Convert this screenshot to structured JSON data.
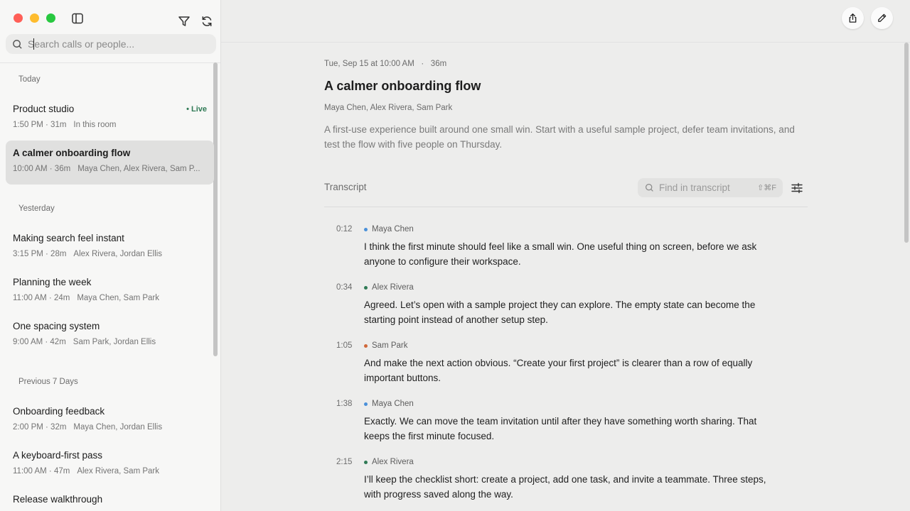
{
  "sidebar": {
    "search_placeholder": "Search calls or people...",
    "groups": [
      {
        "label": "Today"
      },
      {
        "label": "Yesterday"
      },
      {
        "label": "Previous 7 Days"
      }
    ],
    "items": [
      {
        "title": "Product studio",
        "time": "1:50 PM · 31m",
        "people": "In this room",
        "badge": "• Live"
      },
      {
        "title": "A calmer onboarding flow",
        "time": "10:00 AM · 36m",
        "people": "Maya Chen, Alex Rivera, Sam P..."
      },
      {
        "title": "Making search feel instant",
        "time": "3:15 PM · 28m",
        "people": "Alex Rivera, Jordan Ellis"
      },
      {
        "title": "Planning the week",
        "time": "11:00 AM · 24m",
        "people": "Maya Chen, Sam Park"
      },
      {
        "title": "One spacing system",
        "time": "9:00 AM · 42m",
        "people": "Sam Park, Jordan Ellis"
      },
      {
        "title": "Onboarding feedback",
        "time": "2:00 PM · 32m",
        "people": "Maya Chen, Jordan Ellis"
      },
      {
        "title": "A keyboard-first pass",
        "time": "11:00 AM · 47m",
        "people": "Alex Rivera, Sam Park"
      },
      {
        "title": "Release walkthrough",
        "time": "",
        "people": ""
      }
    ]
  },
  "main": {
    "date_line": "Tue, Sep 15 at 10:00 AM   ·   36m",
    "title": "A calmer onboarding flow",
    "participants": "Maya Chen, Alex Rivera, Sam Park",
    "summary": "A first-use experience built around one small win. Start with a useful sample project, defer team invitations, and test the flow with five people on Thursday.",
    "transcript_label": "Transcript",
    "find_placeholder": "Find in transcript",
    "find_shortcut": "⇧⌘F",
    "entries": [
      {
        "time": "0:12",
        "speaker": "Maya Chen",
        "color": "#4a90d9",
        "text": "I think the first minute should feel like a small win. One useful thing on screen, before we ask anyone to configure their workspace."
      },
      {
        "time": "0:34",
        "speaker": "Alex Rivera",
        "color": "#2f7a55",
        "text": "Agreed. Let’s open with a sample project they can explore. The empty state can become the starting point instead of another setup step."
      },
      {
        "time": "1:05",
        "speaker": "Sam Park",
        "color": "#d0683a",
        "text": "And make the next action obvious. “Create your first project” is clearer than a row of equally important buttons."
      },
      {
        "time": "1:38",
        "speaker": "Maya Chen",
        "color": "#4a90d9",
        "text": "Exactly. We can move the team invitation until after they have something worth sharing. That keeps the first minute focused."
      },
      {
        "time": "2:15",
        "speaker": "Alex Rivera",
        "color": "#2f7a55",
        "text": "I’ll keep the checklist short: create a project, add one task, and invite a teammate. Three steps, with progress saved along the way."
      }
    ]
  }
}
